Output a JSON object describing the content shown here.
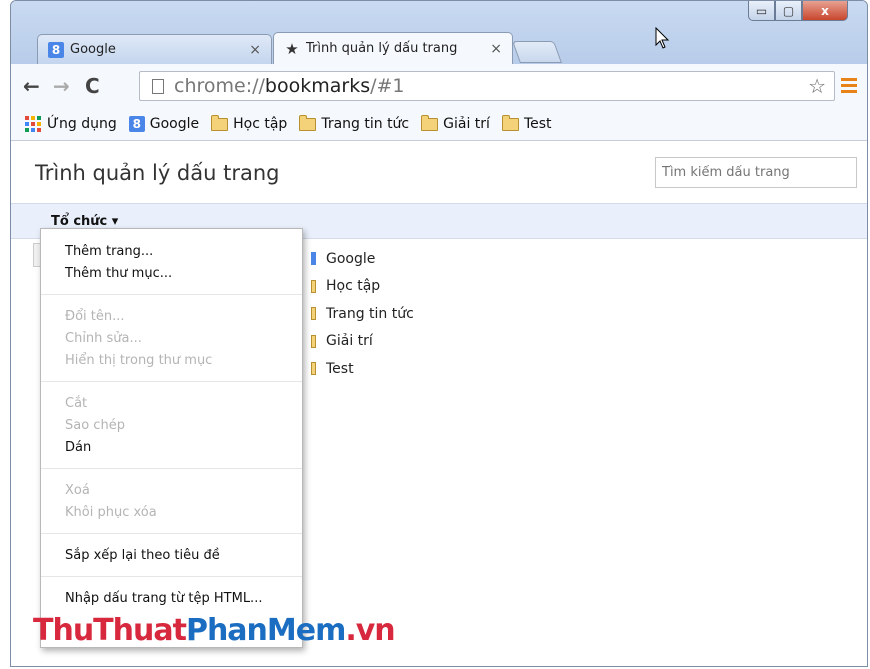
{
  "tabs": [
    {
      "label": "Google",
      "favicon": "google-favicon-icon",
      "favicon_glyph": "8",
      "close": "×"
    },
    {
      "label": "Trình quản lý dấu trang",
      "favicon": "star-icon",
      "favicon_glyph": "★",
      "close": "×"
    }
  ],
  "window": {
    "minimize": "▭",
    "maximize": "▢",
    "close": "x"
  },
  "toolbar": {
    "back": "←",
    "forward": "→",
    "reload": "C",
    "url_scheme": "chrome://",
    "url_host": "bookmarks",
    "url_path": "/#1",
    "star": "☆"
  },
  "bookmarks_bar": [
    {
      "label": "Ứng dụng",
      "icon": "apps-grid-icon"
    },
    {
      "label": "Google",
      "icon": "google-favicon-icon"
    },
    {
      "label": "Học tập",
      "icon": "folder-icon"
    },
    {
      "label": "Trang tin tức",
      "icon": "folder-icon"
    },
    {
      "label": "Giải trí",
      "icon": "folder-icon"
    },
    {
      "label": "Test",
      "icon": "folder-icon"
    }
  ],
  "page": {
    "title": "Trình quản lý dấu trang",
    "search_placeholder": "Tìm kiếm dấu trang",
    "organize_label": "Tổ chức ▾"
  },
  "list_items": [
    "Google",
    "Học tập",
    "Trang tin tức",
    "Giải trí",
    "Test"
  ],
  "menu": {
    "group1": [
      "Thêm trang...",
      "Thêm thư mục..."
    ],
    "group2": [
      "Đổi tên...",
      "Chỉnh sửa...",
      "Hiển thị trong thư mục"
    ],
    "group3": [
      "Cắt",
      "Sao chép",
      "Dán"
    ],
    "group4": [
      "Xoá",
      "Khôi phục xóa"
    ],
    "group5": [
      "Sắp xếp lại theo tiêu đề"
    ],
    "group6": [
      "Nhập dấu trang từ tệp HTML..."
    ]
  },
  "watermark": {
    "part1": "ThuThuat",
    "part2": "PhanMem",
    "part3": ".vn"
  },
  "colors": {
    "accent": "#4a86e8",
    "folder": "#f4d27a",
    "menu_orange": "#e8831a"
  }
}
